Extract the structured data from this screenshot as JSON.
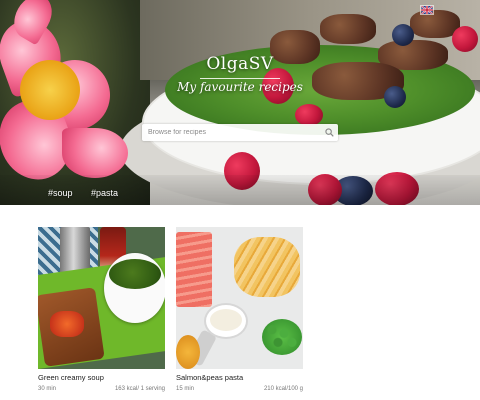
{
  "site": {
    "title": "OlgaSV",
    "tagline": "My favourite recipes"
  },
  "language": {
    "icon": "uk-flag-icon"
  },
  "search": {
    "placeholder": "Browse for recipes",
    "icon": "search-icon"
  },
  "tags": [
    {
      "label": "#soup"
    },
    {
      "label": "#pasta"
    }
  ],
  "recipes": [
    {
      "title": "Green creamy soup",
      "time": "30 min",
      "calories": "163 kcal/ 1 serving"
    },
    {
      "title": "Salmon&peas pasta",
      "time": "15 min",
      "calories": "210 kcal/100 g"
    }
  ]
}
